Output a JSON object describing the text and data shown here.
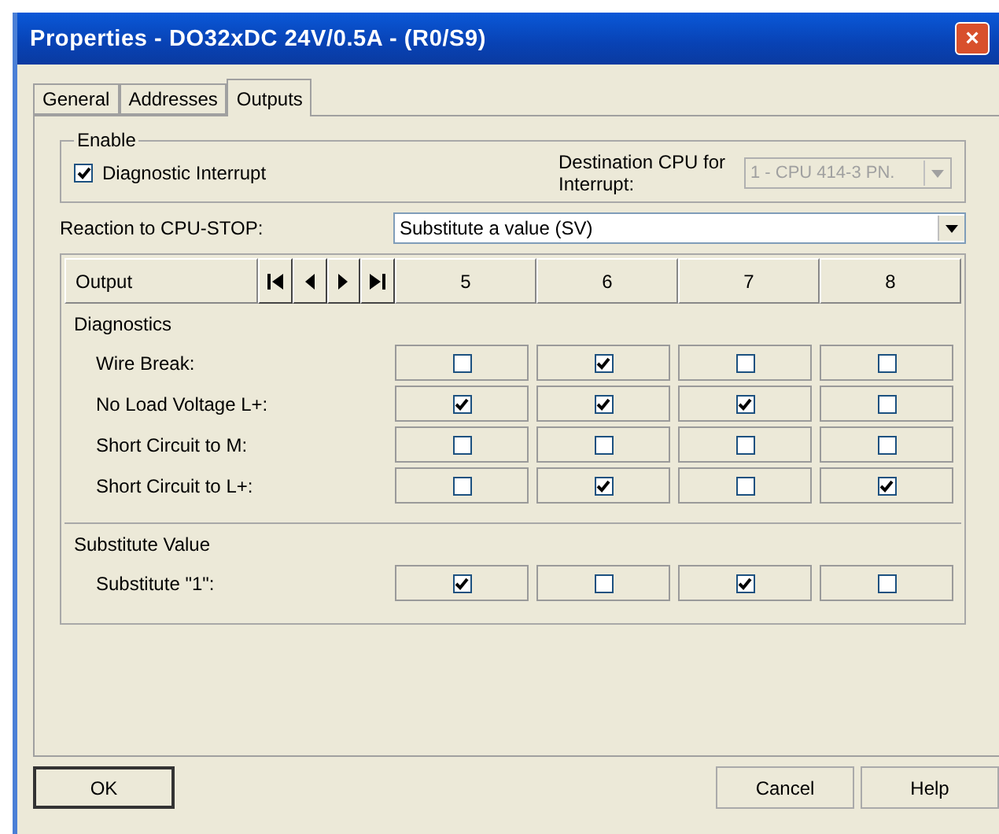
{
  "window": {
    "title": "Properties - DO32xDC 24V/0.5A - (R0/S9)",
    "close": "×"
  },
  "tabs": [
    {
      "label": "General",
      "selected": false
    },
    {
      "label": "Addresses",
      "selected": false
    },
    {
      "label": "Outputs",
      "selected": true
    }
  ],
  "enable": {
    "title": "Enable",
    "diagnostic_interrupt": {
      "label": "Diagnostic Interrupt",
      "checked": true
    },
    "destination_label": "Destination CPU for Interrupt:",
    "destination_value": "1 - CPU 414-3 PN.",
    "destination_disabled": true
  },
  "reaction": {
    "label": "Reaction to CPU-STOP:",
    "value": "Substitute a value (SV)"
  },
  "grid": {
    "header": "Output",
    "columns": [
      "5",
      "6",
      "7",
      "8"
    ]
  },
  "sections": [
    {
      "title": "Diagnostics",
      "rows": [
        {
          "label": "Wire Break:",
          "checked": [
            false,
            true,
            false,
            false
          ]
        },
        {
          "label": "No Load Voltage L+:",
          "checked": [
            true,
            true,
            true,
            false
          ]
        },
        {
          "label": "Short Circuit to M:",
          "checked": [
            false,
            false,
            false,
            false
          ]
        },
        {
          "label": "Short Circuit to L+:",
          "checked": [
            false,
            true,
            false,
            true
          ]
        }
      ]
    },
    {
      "title": "Substitute Value",
      "rows": [
        {
          "label": "Substitute \"1\":",
          "checked": [
            true,
            false,
            true,
            false
          ]
        }
      ]
    }
  ],
  "buttons": {
    "ok": "OK",
    "cancel": "Cancel",
    "help": "Help"
  }
}
